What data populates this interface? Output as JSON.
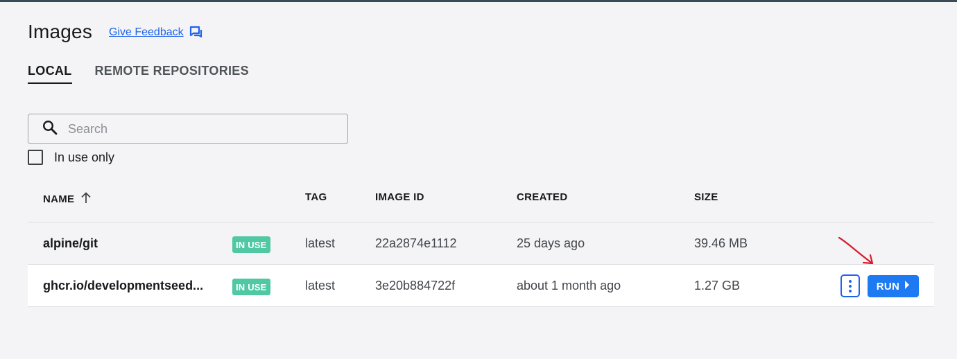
{
  "page": {
    "title": "Images",
    "feedback_label": "Give Feedback",
    "feedback_icon": "chat-bubbles-icon"
  },
  "tabs": [
    {
      "label": "LOCAL",
      "active": true
    },
    {
      "label": "REMOTE REPOSITORIES",
      "active": false
    }
  ],
  "search": {
    "placeholder": "Search",
    "value": "",
    "icon": "search-icon"
  },
  "filter": {
    "label": "In use only",
    "checked": false
  },
  "table": {
    "columns": {
      "name": "NAME",
      "tag": "TAG",
      "image_id": "IMAGE ID",
      "created": "CREATED",
      "size": "SIZE"
    },
    "sort": {
      "column": "name",
      "direction": "ascending",
      "icon": "arrow-up-icon"
    },
    "rows": [
      {
        "name": "alpine/git",
        "badge": "IN USE",
        "tag": "latest",
        "image_id": "22a2874e1112",
        "created": "25 days ago",
        "size": "39.46 MB"
      },
      {
        "name": "ghcr.io/developmentseed...",
        "badge": "IN USE",
        "tag": "latest",
        "image_id": "3e20b884722f",
        "created": "about 1 month ago",
        "size": "1.27 GB",
        "run_label": "RUN"
      }
    ]
  },
  "colors": {
    "accent": "#1d63ed",
    "run_button": "#1d7af2",
    "in_use_badge": "#50c8a3",
    "annotation_arrow": "#d81b2b",
    "background": "#f4f4f6"
  }
}
